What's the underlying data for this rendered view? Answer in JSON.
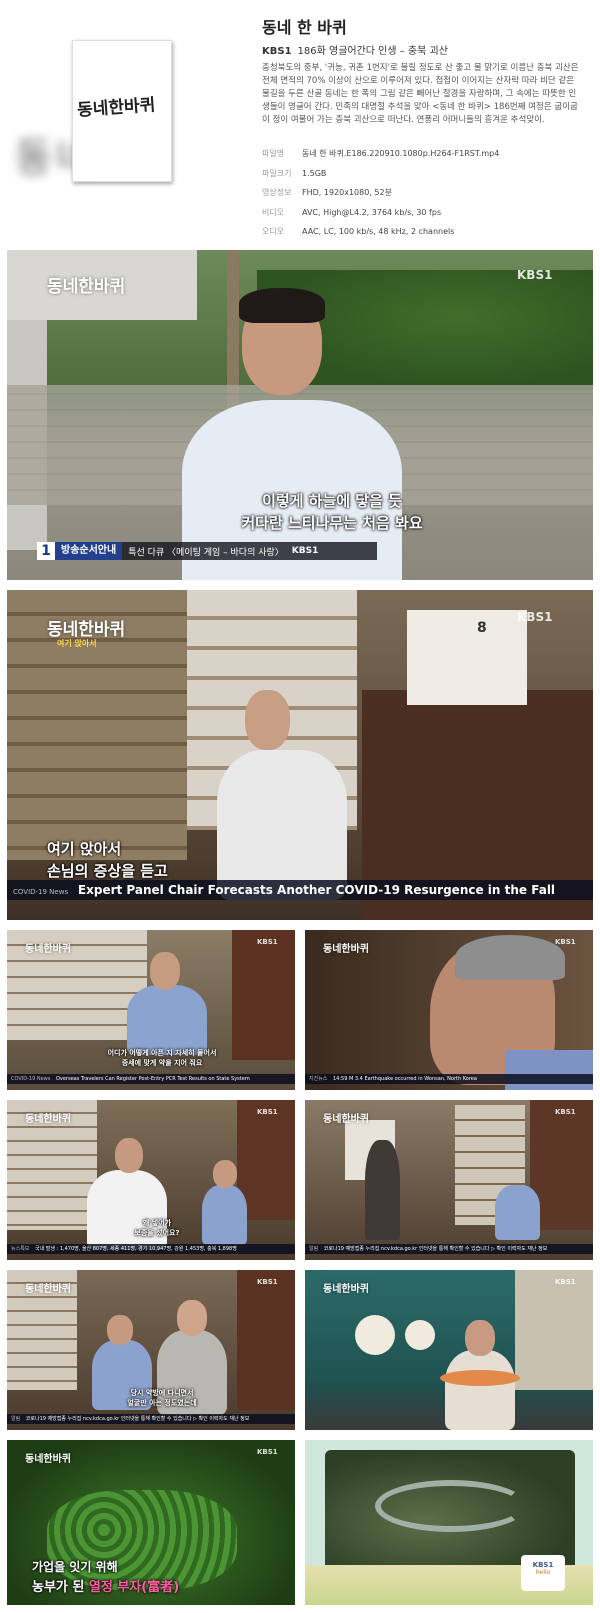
{
  "header": {
    "poster_logo": "동네한바퀴",
    "poster_blur_text": "동네",
    "title": "동네 한 바퀴",
    "channel": "KBS1",
    "episode": "186화 영글어간다 인생 – 충북 괴산",
    "description": "충청북도의 중부, '귀농, 귀촌 1번지'로 불릴 정도로 산 좋고 물 맑기로 이름난 충북 괴산은 전체 면적의 70% 이상이 산으로 이루어져 있다. 첩첩이 이어지는 산자락 따라 비단 같은 물길을 두른 산골 동네는 한 폭의 그림 같은 빼어난 절경을 자랑하며, 그 속에는 따뜻한 인생들이 영글어 간다. 민족의 대명절 추석을 맞아 <동네 한 바퀴> 186번째 여정은 굽이굽이 정이 여물어 가는 충북 괴산으로 떠난다. 연풍리 어머니들의 흥겨운 추석맞이."
  },
  "meta": [
    {
      "label": "파일명",
      "value": "동네 한 바퀴.E186.220910.1080p.H264-F1RST.mp4"
    },
    {
      "label": "파일크기",
      "value": "1.5GB"
    },
    {
      "label": "영상정보",
      "value": "FHD, 1920x1080, 52분"
    },
    {
      "label": "비디오",
      "value": "AVC, High@L4.2, 3764 kb/s, 30 fps"
    },
    {
      "label": "오디오",
      "value": "AAC, LC, 100 kb/s, 48 kHz, 2 channels"
    }
  ],
  "frames": {
    "f1": {
      "logo": "동네한바퀴",
      "kbs": "KBS1",
      "caption1": "이렇게 하늘에 닿을 듯",
      "caption2": "커다란 느티나무는 처음 봐요",
      "num": "1",
      "guide": "방송순서안내",
      "guide_text": "특선 다큐 〈메이팅 게임 – 바다의 사랑〉",
      "guide_kbs": "KBS1"
    },
    "f2": {
      "logo": "동네한바퀴",
      "tag": "여기 앉아서",
      "kbs": "KBS1",
      "caption1": "여기 앉아서",
      "caption2": "손님의 증상을 듣고",
      "news_tag": "COVID-19 News",
      "news": "Expert Panel Chair Forecasts Another COVID-19 Resurgence in the Fall",
      "calendar": "8"
    },
    "f3": {
      "logo": "동네한바퀴",
      "kbs": "KBS1",
      "caption1": "어디가 어떻게 아픈 지 자세히 물어서",
      "caption2": "증세에 맞게 약을 지어 줘요",
      "news_tag": "COVID-19 News",
      "news": "Overseas Travelers Can Register Post-Entry PCR Test Results on State System"
    },
    "f4": {
      "logo": "동네한바퀴",
      "kbs": "KBS1",
      "news_tag": "지진뉴스",
      "news": "14:59 M 3.4 Earthquake occurred in Wonsan, North Korea"
    },
    "f5": {
      "logo": "동네한바퀴",
      "kbs": "KBS1",
      "caption1": "왜 넣어가",
      "caption2": "보증을 섰어요?",
      "news_tag": "뉴스특보",
      "news": "국내 발생 : 1,470명, 울산 807명, 세종 411명, 경기 10,947명, 강원 1,453명, 충북 1,898명"
    },
    "f6": {
      "logo": "동네한바퀴",
      "kbs": "KBS1",
      "news_tag": "알림",
      "news": "코로나19 예방접종 누리집 ncv.kdca.go.kr 인터넷을 통해 확인할 수 있습니다 ▷ 확인 이력자도 재난 정보"
    },
    "f7": {
      "logo": "동네한바퀴",
      "kbs": "KBS1",
      "caption1": "당시 약방에 다니면서",
      "caption2": "얼굴만 아는 정도였는데",
      "news_tag": "알림",
      "news": "코로나19 예방접종 누리집 ncv.kdca.go.kr 인터넷을 통해 확인할 수 있습니다 ▷ 확인 이력자도 재난 정보"
    },
    "f8": {
      "logo": "동네한바퀴",
      "kbs": "KBS1"
    },
    "f9": {
      "logo": "동네한바퀴",
      "kbs": "KBS1",
      "caption1": "가업을 잇기 위해",
      "caption2a": "농부가 된 ",
      "caption2b": "열정 부자(富者)"
    },
    "f10": {
      "kbs": "KBS1",
      "kbs_sub": "hello"
    }
  },
  "colors": {
    "accent_pink": "#ff5fa0",
    "ticker_bg": "#0a0e1e"
  }
}
